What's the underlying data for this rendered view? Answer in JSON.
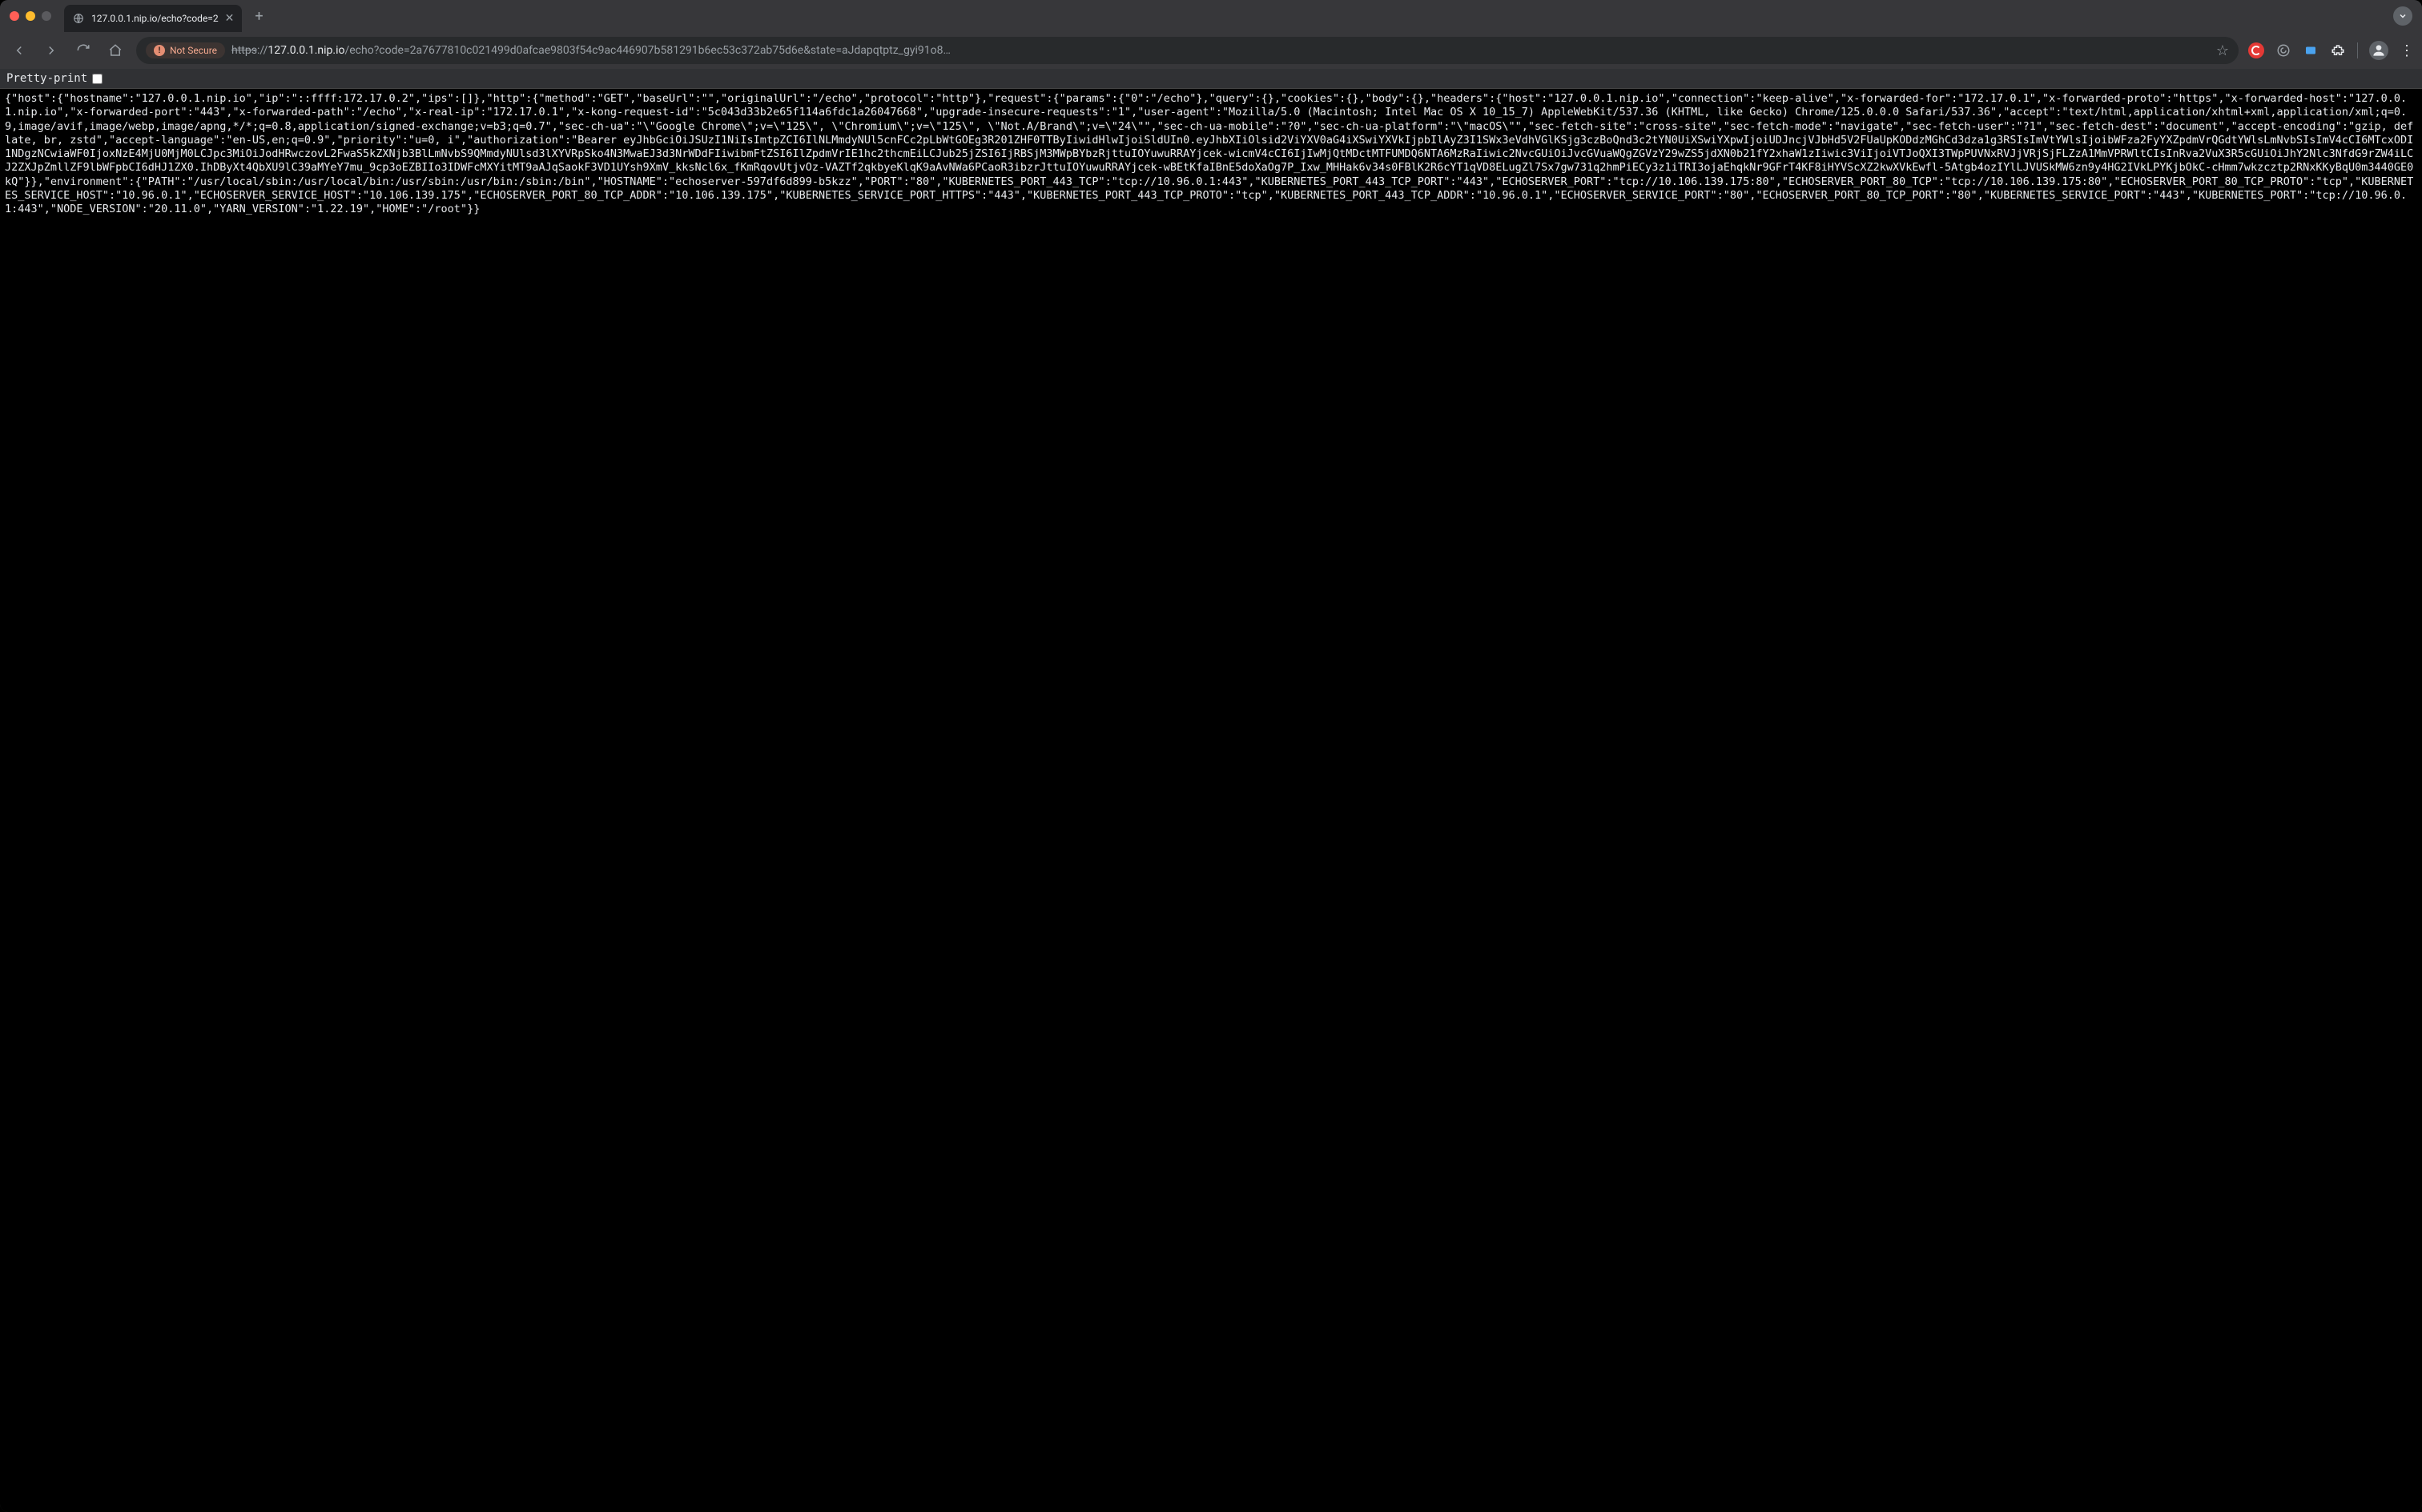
{
  "tab": {
    "title": "127.0.0.1.nip.io/echo?code=2"
  },
  "toolbar": {
    "not_secure_label": "Not Secure",
    "url_scheme": "https",
    "url_scheme_sep": "://",
    "url_host": "127.0.0.1.nip.io",
    "url_rest": "/echo?code=2a7677810c021499d0afcae9803f54c9ac446907b581291b6ec53c372ab75d6e&state=aJdapqtptz_gyi91o8…"
  },
  "pretty_print_label": "Pretty-print",
  "body_text": "{\"host\":{\"hostname\":\"127.0.0.1.nip.io\",\"ip\":\"::ffff:172.17.0.2\",\"ips\":[]},\"http\":{\"method\":\"GET\",\"baseUrl\":\"\",\"originalUrl\":\"/echo\",\"protocol\":\"http\"},\"request\":{\"params\":{\"0\":\"/echo\"},\"query\":{},\"cookies\":{},\"body\":{},\"headers\":{\"host\":\"127.0.0.1.nip.io\",\"connection\":\"keep-alive\",\"x-forwarded-for\":\"172.17.0.1\",\"x-forwarded-proto\":\"https\",\"x-forwarded-host\":\"127.0.0.1.nip.io\",\"x-forwarded-port\":\"443\",\"x-forwarded-path\":\"/echo\",\"x-real-ip\":\"172.17.0.1\",\"x-kong-request-id\":\"5c043d33b2e65f114a6fdc1a26047668\",\"upgrade-insecure-requests\":\"1\",\"user-agent\":\"Mozilla/5.0 (Macintosh; Intel Mac OS X 10_15_7) AppleWebKit/537.36 (KHTML, like Gecko) Chrome/125.0.0.0 Safari/537.36\",\"accept\":\"text/html,application/xhtml+xml,application/xml;q=0.9,image/avif,image/webp,image/apng,*/*;q=0.8,application/signed-exchange;v=b3;q=0.7\",\"sec-ch-ua\":\"\\\"Google Chrome\\\";v=\\\"125\\\", \\\"Chromium\\\";v=\\\"125\\\", \\\"Not.A/Brand\\\";v=\\\"24\\\"\",\"sec-ch-ua-mobile\":\"?0\",\"sec-ch-ua-platform\":\"\\\"macOS\\\"\",\"sec-fetch-site\":\"cross-site\",\"sec-fetch-mode\":\"navigate\",\"sec-fetch-user\":\"?1\",\"sec-fetch-dest\":\"document\",\"accept-encoding\":\"gzip, deflate, br, zstd\",\"accept-language\":\"en-US,en;q=0.9\",\"priority\":\"u=0, i\",\"authorization\":\"Bearer eyJhbGciOiJSUzI1NiIsImtpZCI6IlNLMmdyNUl5cnFCc2pLbWtGOEg3R201ZHF0TTByIiwidHlwIjoiSldUIn0.eyJhbXIiOlsid2ViYXV0aG4iXSwiYXVkIjpbIlAyZ3I1SWx3eVdhVGlKSjg3czBoQnd3c2tYN0UiXSwiYXpwIjoiUDJncjVJbHd5V2FUaUpKODdzMGhCd3dza1g3RSIsImVtYWlsIjoibWFza2FyYXZpdmVrQGdtYWlsLmNvbSIsImV4cCI6MTcxODI1NDgzNCwiaWF0IjoxNzE4MjU0MjM0LCJpc3MiOiJodHRwczovL2FwaS5kZXNjb3BlLmNvbS9QMmdyNUlsd3lXYVRpSko4N3MwaEJ3d3NrWDdFIiwibmFtZSI6IlZpdmVrIE1hc2thcmEiLCJub25jZSI6IjRBSjM3MWpBYbzRjttuIOYuwuRRAYjcek-wicmV4cCI6IjIwMjQtMDctMTFUMDQ6NTA6MzRaIiwic2NvcGUiOiJvcGVuaWQgZGVzY29wZS5jdXN0b21fY2xhaW1zIiwic3ViIjoiVTJoQXI3TWpPUVNxRVJjVRjSjFLZzA1MmVPRWltCIsInRva2VuX3R5cGUiOiJhY2Nlc3NfdG9rZW4iLCJ2ZXJpZmllZF9lbWFpbCI6dHJ1ZX0.IhDByXt4QbXU9lC39aMYeY7mu_9cp3oEZBIIo3IDWFcMXYitMT9aAJqSaokF3VD1UYsh9XmV_kksNcl6x_fKmRqovUtjvOz-VAZTf2qkbyeKlqK9aAvNWa6PCaoR3ibzrJttuIOYuwuRRAYjcek-wBEtKfaIBnE5doXaOg7P_Ixw_MHHak6v34s0FBlK2R6cYT1qVD8ELugZl7Sx7gw731q2hmPiECy3z1iTRI3ojaEhqkNr9GFrT4KF8iHYVScXZ2kwXVkEwfl-5Atgb4ozIYlLJVUSkMW6zn9y4HG2IVkLPYKjbOkC-cHmm7wkzcztp2RNxKKyBqU0m3440GE0kQ\"}},\"environment\":{\"PATH\":\"/usr/local/sbin:/usr/local/bin:/usr/sbin:/usr/bin:/sbin:/bin\",\"HOSTNAME\":\"echoserver-597df6d899-b5kzz\",\"PORT\":\"80\",\"KUBERNETES_PORT_443_TCP\":\"tcp://10.96.0.1:443\",\"KUBERNETES_PORT_443_TCP_PORT\":\"443\",\"ECHOSERVER_PORT\":\"tcp://10.106.139.175:80\",\"ECHOSERVER_PORT_80_TCP\":\"tcp://10.106.139.175:80\",\"ECHOSERVER_PORT_80_TCP_PROTO\":\"tcp\",\"KUBERNETES_SERVICE_HOST\":\"10.96.0.1\",\"ECHOSERVER_SERVICE_HOST\":\"10.106.139.175\",\"ECHOSERVER_PORT_80_TCP_ADDR\":\"10.106.139.175\",\"KUBERNETES_SERVICE_PORT_HTTPS\":\"443\",\"KUBERNETES_PORT_443_TCP_PROTO\":\"tcp\",\"KUBERNETES_PORT_443_TCP_ADDR\":\"10.96.0.1\",\"ECHOSERVER_SERVICE_PORT\":\"80\",\"ECHOSERVER_PORT_80_TCP_PORT\":\"80\",\"KUBERNETES_SERVICE_PORT\":\"443\",\"KUBERNETES_PORT\":\"tcp://10.96.0.1:443\",\"NODE_VERSION\":\"20.11.0\",\"YARN_VERSION\":\"1.22.19\",\"HOME\":\"/root\"}}"
}
